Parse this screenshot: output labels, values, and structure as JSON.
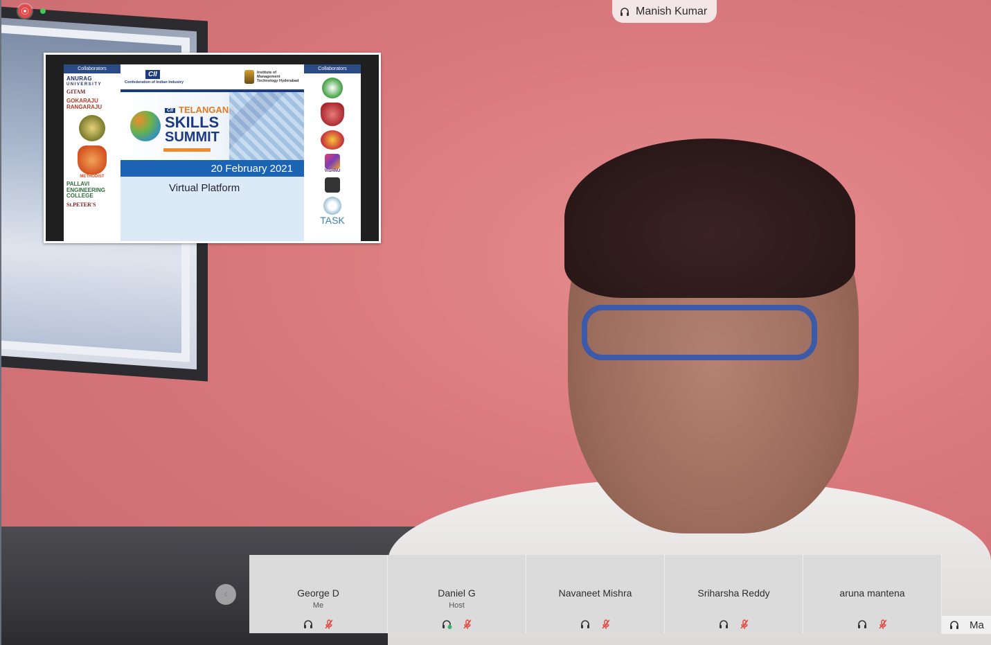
{
  "window": {
    "record_icon": "record-icon"
  },
  "speaker": {
    "name": "Manish Kumar",
    "icon": "headphone-icon"
  },
  "shared_screen": {
    "collaborators_left_header": "Collaborators",
    "collaborators_right_header": "Collaborators",
    "left_logos": {
      "anurag": "ANURAG",
      "anurag_sub": "UNIVERSITY",
      "gitam": "GITAM",
      "gokaraju": "GOKARAJU RANGARAJU",
      "methodist": "METHODIST",
      "pallavi": "PALLAVI ENGINEERING COLLEGE",
      "stpeters": "St.PETER'S"
    },
    "right_logos": {
      "vishnu": "VISHNU",
      "task": "TASK"
    },
    "cii_logo": "CII",
    "cii_sub": "Confederation of Indian Industry",
    "imt_text": "Institute of Management Technology Hyderabad",
    "title_cii": "CII",
    "title_telangana": "TELANGANA",
    "title_skills": "SKILLS",
    "title_summit": "SUMMIT",
    "date": "20 February 2021",
    "platform": "Virtual Platform"
  },
  "participants": [
    {
      "name": "George D",
      "role": "Me",
      "audio_icon": "headphone-icon",
      "mic_icon": "mic-muted-icon"
    },
    {
      "name": "Daniel G",
      "role": "Host",
      "audio_icon": "headphone-active-icon",
      "mic_icon": "mic-muted-icon"
    },
    {
      "name": "Navaneet Mishra",
      "role": "",
      "audio_icon": "headphone-icon",
      "mic_icon": "mic-muted-icon"
    },
    {
      "name": "Sriharsha Reddy",
      "role": "",
      "audio_icon": "headphone-icon",
      "mic_icon": "mic-muted-icon"
    },
    {
      "name": "aruna mantena",
      "role": "",
      "audio_icon": "headphone-icon",
      "mic_icon": "mic-muted-icon"
    }
  ],
  "overflow_participant": {
    "name_partial": "Ma"
  },
  "colors": {
    "wall": "#d97a7e",
    "strip_tile": "#dbdbdb",
    "mic_muted": "#e0453e",
    "brand_blue": "#1b3a82"
  }
}
